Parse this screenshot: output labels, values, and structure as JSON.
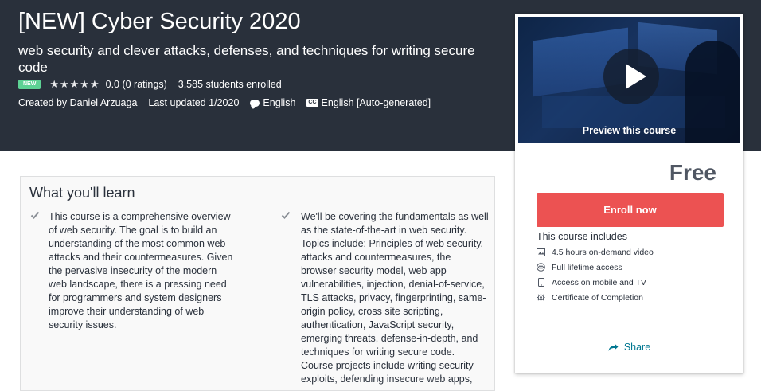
{
  "header": {
    "title": "[NEW] Cyber Security 2020",
    "subtitle": "web security and clever attacks, defenses, and techniques for writing secure code",
    "badge": "NEW",
    "rating": "0.0 (0 ratings)",
    "stars": 0,
    "students": "3,585 students enrolled",
    "created_by": "Created by Daniel Arzuaga",
    "last_updated": "Last updated 1/2020",
    "language": "English",
    "captions": "English [Auto-generated]",
    "captions_icon_text": "CC"
  },
  "sidebar": {
    "preview_label": "Preview this course",
    "price": "Free",
    "enroll_label": "Enroll now",
    "includes_title": "This course includes",
    "includes": [
      {
        "icon": "video-icon",
        "label": "4.5 hours on-demand video"
      },
      {
        "icon": "infinity-icon",
        "label": "Full lifetime access"
      },
      {
        "icon": "mobile-icon",
        "label": "Access on mobile and TV"
      },
      {
        "icon": "certificate-icon",
        "label": "Certificate of Completion"
      }
    ],
    "share_label": "Share"
  },
  "learn": {
    "title": "What you'll learn",
    "items": [
      "This course is a comprehensive overview of web security. The goal is to build an understanding of the most common web attacks and their countermeasures. Given the pervasive insecurity of the modern web landscape, there is a pressing need for programmers and system designers improve their understanding of web security issues.",
      "We'll be covering the fundamentals as well as the state-of-the-art in web security. Topics include: Principles of web security, attacks and countermeasures, the browser security model, web app vulnerabilities, injection, denial-of-service, TLS attacks, privacy, fingerprinting, same-origin policy, cross site scripting, authentication, JavaScript security, emerging threats, defense-in-depth, and techniques for writing secure code. Course projects include writing security exploits, defending insecure web apps,"
    ]
  },
  "colors": {
    "hero_bg": "#29303b",
    "enroll_bg": "#ec5252",
    "badge_bg": "#5dd294",
    "link": "#007791"
  }
}
